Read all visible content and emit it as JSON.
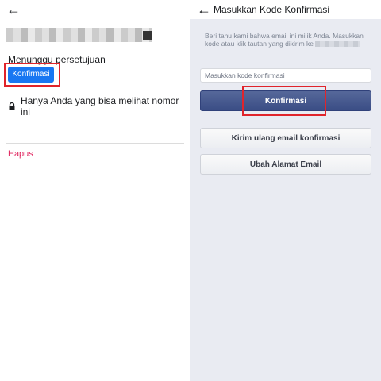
{
  "left_panel": {
    "pending_label": "Menunggu persetujuan",
    "confirm_button": "Konfirmasi",
    "privacy_text": "Hanya Anda yang bisa melihat nomor ini",
    "delete_link": "Hapus"
  },
  "right_panel": {
    "title": "Masukkan Kode Konfirmasi",
    "info_text": "Beri tahu kami bahwa email ini milik Anda. Masukkan kode atau klik tautan yang dikirim ke",
    "code_placeholder": "Masukkan kode konfirmasi",
    "confirm_button": "Konfirmasi",
    "resend_button": "Kirim ulang email konfirmasi",
    "change_email_button": "Ubah Alamat Email"
  },
  "colors": {
    "primary_blue": "#1877f2",
    "highlight_red": "#e0242b",
    "delete_red": "#e0245e",
    "navy_button": "#3a4d85",
    "right_background": "#e9ebf2"
  },
  "icons": [
    "back-arrow-icon",
    "lock-icon"
  ]
}
